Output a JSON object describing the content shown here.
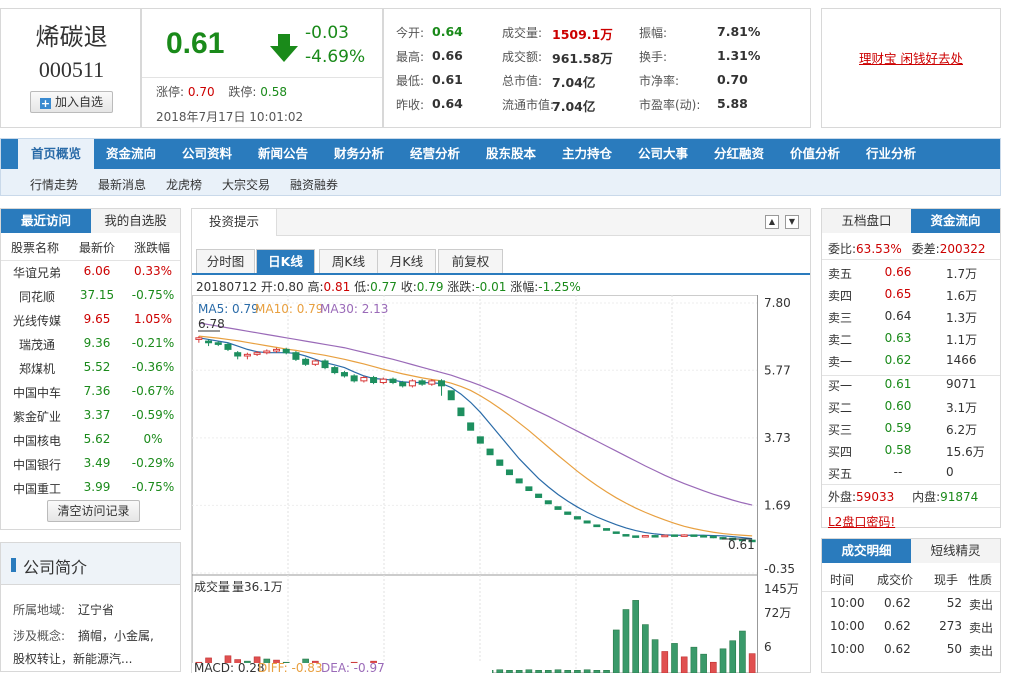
{
  "stock": {
    "name": "烯碳退",
    "code": "000511",
    "add_label": "加入自选",
    "price": "0.61",
    "change": "-0.03",
    "change_pct": "-4.69%",
    "limit_up_label": "涨停:",
    "limit_up": "0.70",
    "limit_down_label": "跌停:",
    "limit_down": "0.58",
    "datetime": "2018年7月17日 10:01:02"
  },
  "stats": [
    {
      "label": "今开:",
      "value": "0.64",
      "color": "#1a8a1a"
    },
    {
      "label": "成交量:",
      "value": "1509.1万",
      "color": "#c00"
    },
    {
      "label": "振幅:",
      "value": "7.81%",
      "color": "#333"
    },
    {
      "label": "最高:",
      "value": "0.66",
      "color": "#333"
    },
    {
      "label": "成交额:",
      "value": "961.58万",
      "color": "#333"
    },
    {
      "label": "换手:",
      "value": "1.31%",
      "color": "#333"
    },
    {
      "label": "最低:",
      "value": "0.61",
      "color": "#333"
    },
    {
      "label": "总市值:",
      "value": "7.04亿",
      "color": "#333"
    },
    {
      "label": "市净率:",
      "value": "0.70",
      "color": "#333"
    },
    {
      "label": "昨收:",
      "value": "0.64",
      "color": "#333"
    },
    {
      "label": "流通市值:",
      "value": "7.04亿",
      "color": "#333"
    },
    {
      "label": "市盈率(动):",
      "value": "5.88",
      "color": "#333"
    }
  ],
  "ad_text": "理财宝 闲钱好去处",
  "nav": [
    "首页概览",
    "资金流向",
    "公司资料",
    "新闻公告",
    "财务分析",
    "经营分析",
    "股东股本",
    "主力持仓",
    "公司大事",
    "分红融资",
    "价值分析",
    "行业分析"
  ],
  "subnav": [
    "行情走势",
    "最新消息",
    "龙虎榜",
    "大宗交易",
    "融资融券"
  ],
  "recent": {
    "tabs": [
      "最近访问",
      "我的自选股"
    ],
    "headers": [
      "股票名称",
      "最新价",
      "涨跌幅"
    ],
    "rows": [
      {
        "name": "华谊兄弟",
        "price": "6.06",
        "pct": "0.33%",
        "up": 1
      },
      {
        "name": "同花顺",
        "price": "37.15",
        "pct": "-0.75%",
        "up": -1
      },
      {
        "name": "光线传媒",
        "price": "9.65",
        "pct": "1.05%",
        "up": 1
      },
      {
        "name": "瑞茂通",
        "price": "9.36",
        "pct": "-0.21%",
        "up": -1
      },
      {
        "name": "郑煤机",
        "price": "5.52",
        "pct": "-0.36%",
        "up": -1
      },
      {
        "name": "中国中车",
        "price": "7.36",
        "pct": "-0.67%",
        "up": -1
      },
      {
        "name": "紫金矿业",
        "price": "3.37",
        "pct": "-0.59%",
        "up": -1
      },
      {
        "name": "中国核电",
        "price": "5.62",
        "pct": "0%",
        "up": 0
      },
      {
        "name": "中国银行",
        "price": "3.49",
        "pct": "-0.29%",
        "up": -1
      },
      {
        "name": "中国重工",
        "price": "3.99",
        "pct": "-0.75%",
        "up": -1
      }
    ],
    "clear_label": "清空访问记录"
  },
  "company": {
    "title": "公司简介",
    "region_label": "所属地域:",
    "region": "辽宁省",
    "concept_label": "涉及概念:",
    "concept": "摘帽，小金属,",
    "concept2": "股权转让，新能源汽..."
  },
  "chart_header": {
    "title": "投资提示",
    "tabs": [
      "分时图",
      "日K线",
      "周K线",
      "月K线",
      "前复权"
    ],
    "active_tab": 1
  },
  "kline_info": {
    "date": "20180712",
    "open_label": "开:",
    "open": "0.80",
    "high_label": "高:",
    "high": "0.81",
    "low_label": "低:",
    "low": "0.77",
    "close_label": "收:",
    "close": "0.79",
    "chg_label": "涨跌:",
    "chg": "-0.01",
    "pct_label": "涨幅:",
    "pct": "-1.25%"
  },
  "ma_info": {
    "ma5": "MA5: 0.79",
    "ma10": "MA10: 0.79",
    "ma30": "MA30: 2.13",
    "ma5_color": "#2a6ba8",
    "ma10_color": "#e8a040",
    "ma30_color": "#9a6ab8"
  },
  "chart_data": {
    "type": "candlestick",
    "ylim": [
      -0.35,
      7.8
    ],
    "yticks": [
      "7.80",
      "5.77",
      "3.73",
      "1.69",
      "-0.35"
    ],
    "max_label": "6.78",
    "last_label": "0.61",
    "candles": [
      [
        6.7,
        6.75,
        6.8,
        6.6
      ],
      [
        6.65,
        6.6,
        6.7,
        6.5
      ],
      [
        6.6,
        6.55,
        6.65,
        6.5
      ],
      [
        6.55,
        6.4,
        6.6,
        6.35
      ],
      [
        6.3,
        6.2,
        6.35,
        6.1
      ],
      [
        6.2,
        6.25,
        6.3,
        6.1
      ],
      [
        6.25,
        6.3,
        6.35,
        6.2
      ],
      [
        6.3,
        6.35,
        6.4,
        6.25
      ],
      [
        6.35,
        6.4,
        6.45,
        6.3
      ],
      [
        6.4,
        6.3,
        6.45,
        6.25
      ],
      [
        6.3,
        6.1,
        6.35,
        6.05
      ],
      [
        6.1,
        5.95,
        6.15,
        5.9
      ],
      [
        5.95,
        6.05,
        6.1,
        5.9
      ],
      [
        6.05,
        5.85,
        6.1,
        5.8
      ],
      [
        5.85,
        5.7,
        5.9,
        5.65
      ],
      [
        5.7,
        5.6,
        5.75,
        5.55
      ],
      [
        5.6,
        5.45,
        5.65,
        5.4
      ],
      [
        5.45,
        5.55,
        5.6,
        5.4
      ],
      [
        5.55,
        5.4,
        5.6,
        5.35
      ],
      [
        5.4,
        5.5,
        5.55,
        5.35
      ],
      [
        5.5,
        5.4,
        5.55,
        5.35
      ],
      [
        5.4,
        5.3,
        5.45,
        5.25
      ],
      [
        5.3,
        5.45,
        5.5,
        5.25
      ],
      [
        5.45,
        5.35,
        5.5,
        5.3
      ],
      [
        5.35,
        5.45,
        5.5,
        5.3
      ],
      [
        5.45,
        5.3,
        5.5,
        5.0
      ],
      [
        5.15,
        4.88,
        5.15,
        4.88
      ],
      [
        4.63,
        4.4,
        4.63,
        4.4
      ],
      [
        4.18,
        3.96,
        4.18,
        3.96
      ],
      [
        3.76,
        3.57,
        3.76,
        3.57
      ],
      [
        3.39,
        3.22,
        3.39,
        3.22
      ],
      [
        3.06,
        2.9,
        3.06,
        2.9
      ],
      [
        2.76,
        2.62,
        2.76,
        2.62
      ],
      [
        2.49,
        2.37,
        2.49,
        2.37
      ],
      [
        2.25,
        2.14,
        2.25,
        2.14
      ],
      [
        2.03,
        1.93,
        2.03,
        1.93
      ],
      [
        1.83,
        1.74,
        1.83,
        1.74
      ],
      [
        1.65,
        1.57,
        1.65,
        1.57
      ],
      [
        1.49,
        1.42,
        1.49,
        1.42
      ],
      [
        1.35,
        1.28,
        1.35,
        1.28
      ],
      [
        1.22,
        1.16,
        1.22,
        1.16
      ],
      [
        1.1,
        1.05,
        1.1,
        1.05
      ],
      [
        0.99,
        0.94,
        0.99,
        0.94
      ],
      [
        0.89,
        0.85,
        0.89,
        0.85
      ],
      [
        0.81,
        0.77,
        0.81,
        0.77
      ],
      [
        0.77,
        0.76,
        0.78,
        0.75
      ],
      [
        0.76,
        0.78,
        0.79,
        0.75
      ],
      [
        0.78,
        0.77,
        0.8,
        0.76
      ],
      [
        0.77,
        0.79,
        0.81,
        0.76
      ],
      [
        0.8,
        0.79,
        0.81,
        0.77
      ],
      [
        0.79,
        0.8,
        0.82,
        0.78
      ],
      [
        0.8,
        0.78,
        0.81,
        0.77
      ],
      [
        0.78,
        0.76,
        0.79,
        0.75
      ],
      [
        0.76,
        0.72,
        0.77,
        0.7
      ],
      [
        0.72,
        0.7,
        0.74,
        0.68
      ],
      [
        0.7,
        0.67,
        0.71,
        0.66
      ],
      [
        0.67,
        0.64,
        0.68,
        0.63
      ],
      [
        0.64,
        0.61,
        0.66,
        0.61
      ]
    ],
    "ma5": [
      6.75,
      6.7,
      6.65,
      6.6,
      6.5,
      6.4,
      6.33,
      6.3,
      6.3,
      6.3,
      6.28,
      6.2,
      6.1,
      6.0,
      5.93,
      5.85,
      5.72,
      5.6,
      5.52,
      5.5,
      5.47,
      5.42,
      5.4,
      5.4,
      5.39,
      5.37,
      5.25,
      5.05,
      4.8,
      4.5,
      4.15,
      3.8,
      3.45,
      3.1,
      2.8,
      2.5,
      2.25,
      2.02,
      1.82,
      1.64,
      1.48,
      1.34,
      1.22,
      1.11,
      1.01,
      0.93,
      0.87,
      0.83,
      0.8,
      0.79,
      0.79,
      0.79,
      0.79,
      0.78,
      0.77,
      0.75,
      0.72,
      0.69
    ],
    "ma10": [
      6.8,
      6.77,
      6.74,
      6.7,
      6.66,
      6.61,
      6.56,
      6.51,
      6.46,
      6.41,
      6.37,
      6.32,
      6.27,
      6.22,
      6.16,
      6.1,
      6.03,
      5.96,
      5.88,
      5.8,
      5.73,
      5.66,
      5.6,
      5.54,
      5.49,
      5.45,
      5.38,
      5.28,
      5.16,
      5.0,
      4.82,
      4.62,
      4.41,
      4.18,
      3.95,
      3.7,
      3.45,
      3.2,
      2.96,
      2.72,
      2.5,
      2.29,
      2.1,
      1.92,
      1.76,
      1.61,
      1.48,
      1.36,
      1.25,
      1.15,
      1.06,
      0.99,
      0.93,
      0.88,
      0.84,
      0.81,
      0.79,
      0.77
    ],
    "ma30": [
      7.2,
      7.15,
      7.1,
      7.05,
      7.0,
      6.95,
      6.9,
      6.85,
      6.8,
      6.75,
      6.7,
      6.65,
      6.6,
      6.55,
      6.5,
      6.45,
      6.38,
      6.31,
      6.24,
      6.17,
      6.1,
      6.02,
      5.94,
      5.86,
      5.78,
      5.7,
      5.62,
      5.52,
      5.42,
      5.31,
      5.19,
      5.07,
      4.94,
      4.8,
      4.66,
      4.52,
      4.38,
      4.23,
      4.08,
      3.93,
      3.78,
      3.63,
      3.48,
      3.33,
      3.18,
      3.03,
      2.88,
      2.74,
      2.6,
      2.47,
      2.35,
      2.24,
      2.13,
      2.03,
      1.94,
      1.85,
      1.77,
      1.7
    ],
    "volume_label": "成交量",
    "volume_value": "量36.1万",
    "vol_yticks": [
      "145万",
      "72万",
      "6"
    ],
    "vol_max": 145,
    "volumes": [
      [
        20,
        1
      ],
      [
        28,
        1
      ],
      [
        18,
        -1
      ],
      [
        32,
        1
      ],
      [
        25,
        1
      ],
      [
        22,
        -1
      ],
      [
        30,
        1
      ],
      [
        26,
        -1
      ],
      [
        24,
        1
      ],
      [
        20,
        -1
      ],
      [
        18,
        1
      ],
      [
        26,
        -1
      ],
      [
        22,
        1
      ],
      [
        15,
        -1
      ],
      [
        18,
        1
      ],
      [
        14,
        -1
      ],
      [
        20,
        1
      ],
      [
        16,
        -1
      ],
      [
        22,
        1
      ],
      [
        18,
        -1
      ],
      [
        14,
        1
      ],
      [
        12,
        -1
      ],
      [
        16,
        1
      ],
      [
        14,
        -1
      ],
      [
        12,
        1
      ],
      [
        15,
        -1
      ],
      [
        6,
        -1
      ],
      [
        5,
        -1
      ],
      [
        5,
        -1
      ],
      [
        6,
        -1
      ],
      [
        5,
        -1
      ],
      [
        6,
        -1
      ],
      [
        5,
        -1
      ],
      [
        5,
        -1
      ],
      [
        6,
        -1
      ],
      [
        5,
        -1
      ],
      [
        5,
        -1
      ],
      [
        6,
        -1
      ],
      [
        5,
        -1
      ],
      [
        5,
        -1
      ],
      [
        6,
        -1
      ],
      [
        5,
        -1
      ],
      [
        5,
        -1
      ],
      [
        80,
        -1
      ],
      [
        118,
        -1
      ],
      [
        135,
        -1
      ],
      [
        90,
        -1
      ],
      [
        62,
        -1
      ],
      [
        40,
        1
      ],
      [
        55,
        -1
      ],
      [
        30,
        1
      ],
      [
        48,
        -1
      ],
      [
        35,
        -1
      ],
      [
        20,
        1
      ],
      [
        45,
        -1
      ],
      [
        60,
        -1
      ],
      [
        78,
        -1
      ],
      [
        36,
        1
      ]
    ],
    "macd_label": "MACD: 0.28",
    "diff_label": "DIFF: -0.83",
    "dea_label": "DEA: -0.97"
  },
  "orderbook": {
    "tabs": [
      "五档盘口",
      "资金流向"
    ],
    "ratio_label": "委比:",
    "ratio": "63.53%",
    "diff_label": "委差:",
    "diff": "200322",
    "sells": [
      {
        "label": "卖五",
        "price": "0.66",
        "vol": "1.7万",
        "color": "#c00"
      },
      {
        "label": "卖四",
        "price": "0.65",
        "vol": "1.6万",
        "color": "#c00"
      },
      {
        "label": "卖三",
        "price": "0.64",
        "vol": "1.3万",
        "color": "#333"
      },
      {
        "label": "卖二",
        "price": "0.63",
        "vol": "1.1万",
        "color": "#1a8a1a"
      },
      {
        "label": "卖一",
        "price": "0.62",
        "vol": "1466",
        "color": "#1a8a1a"
      }
    ],
    "buys": [
      {
        "label": "买一",
        "price": "0.61",
        "vol": "9071",
        "color": "#1a8a1a"
      },
      {
        "label": "买二",
        "price": "0.60",
        "vol": "3.1万",
        "color": "#1a8a1a"
      },
      {
        "label": "买三",
        "price": "0.59",
        "vol": "6.2万",
        "color": "#1a8a1a"
      },
      {
        "label": "买四",
        "price": "0.58",
        "vol": "15.6万",
        "color": "#1a8a1a"
      },
      {
        "label": "买五",
        "price": "--",
        "vol": "0",
        "color": "#333"
      }
    ],
    "outer_label": "外盘:",
    "outer": "59033",
    "inner_label": "内盘:",
    "inner": "91874",
    "l2_label": "L2盘口密码!"
  },
  "trades": {
    "tabs": [
      "成交明细",
      "短线精灵"
    ],
    "headers": [
      "时间",
      "成交价",
      "现手",
      "性质"
    ],
    "rows": [
      {
        "time": "10:00",
        "price": "0.62",
        "vol": "52",
        "type": "卖出"
      },
      {
        "time": "10:00",
        "price": "0.62",
        "vol": "273",
        "type": "卖出"
      },
      {
        "time": "10:00",
        "price": "0.62",
        "vol": "50",
        "type": "卖出"
      }
    ]
  }
}
